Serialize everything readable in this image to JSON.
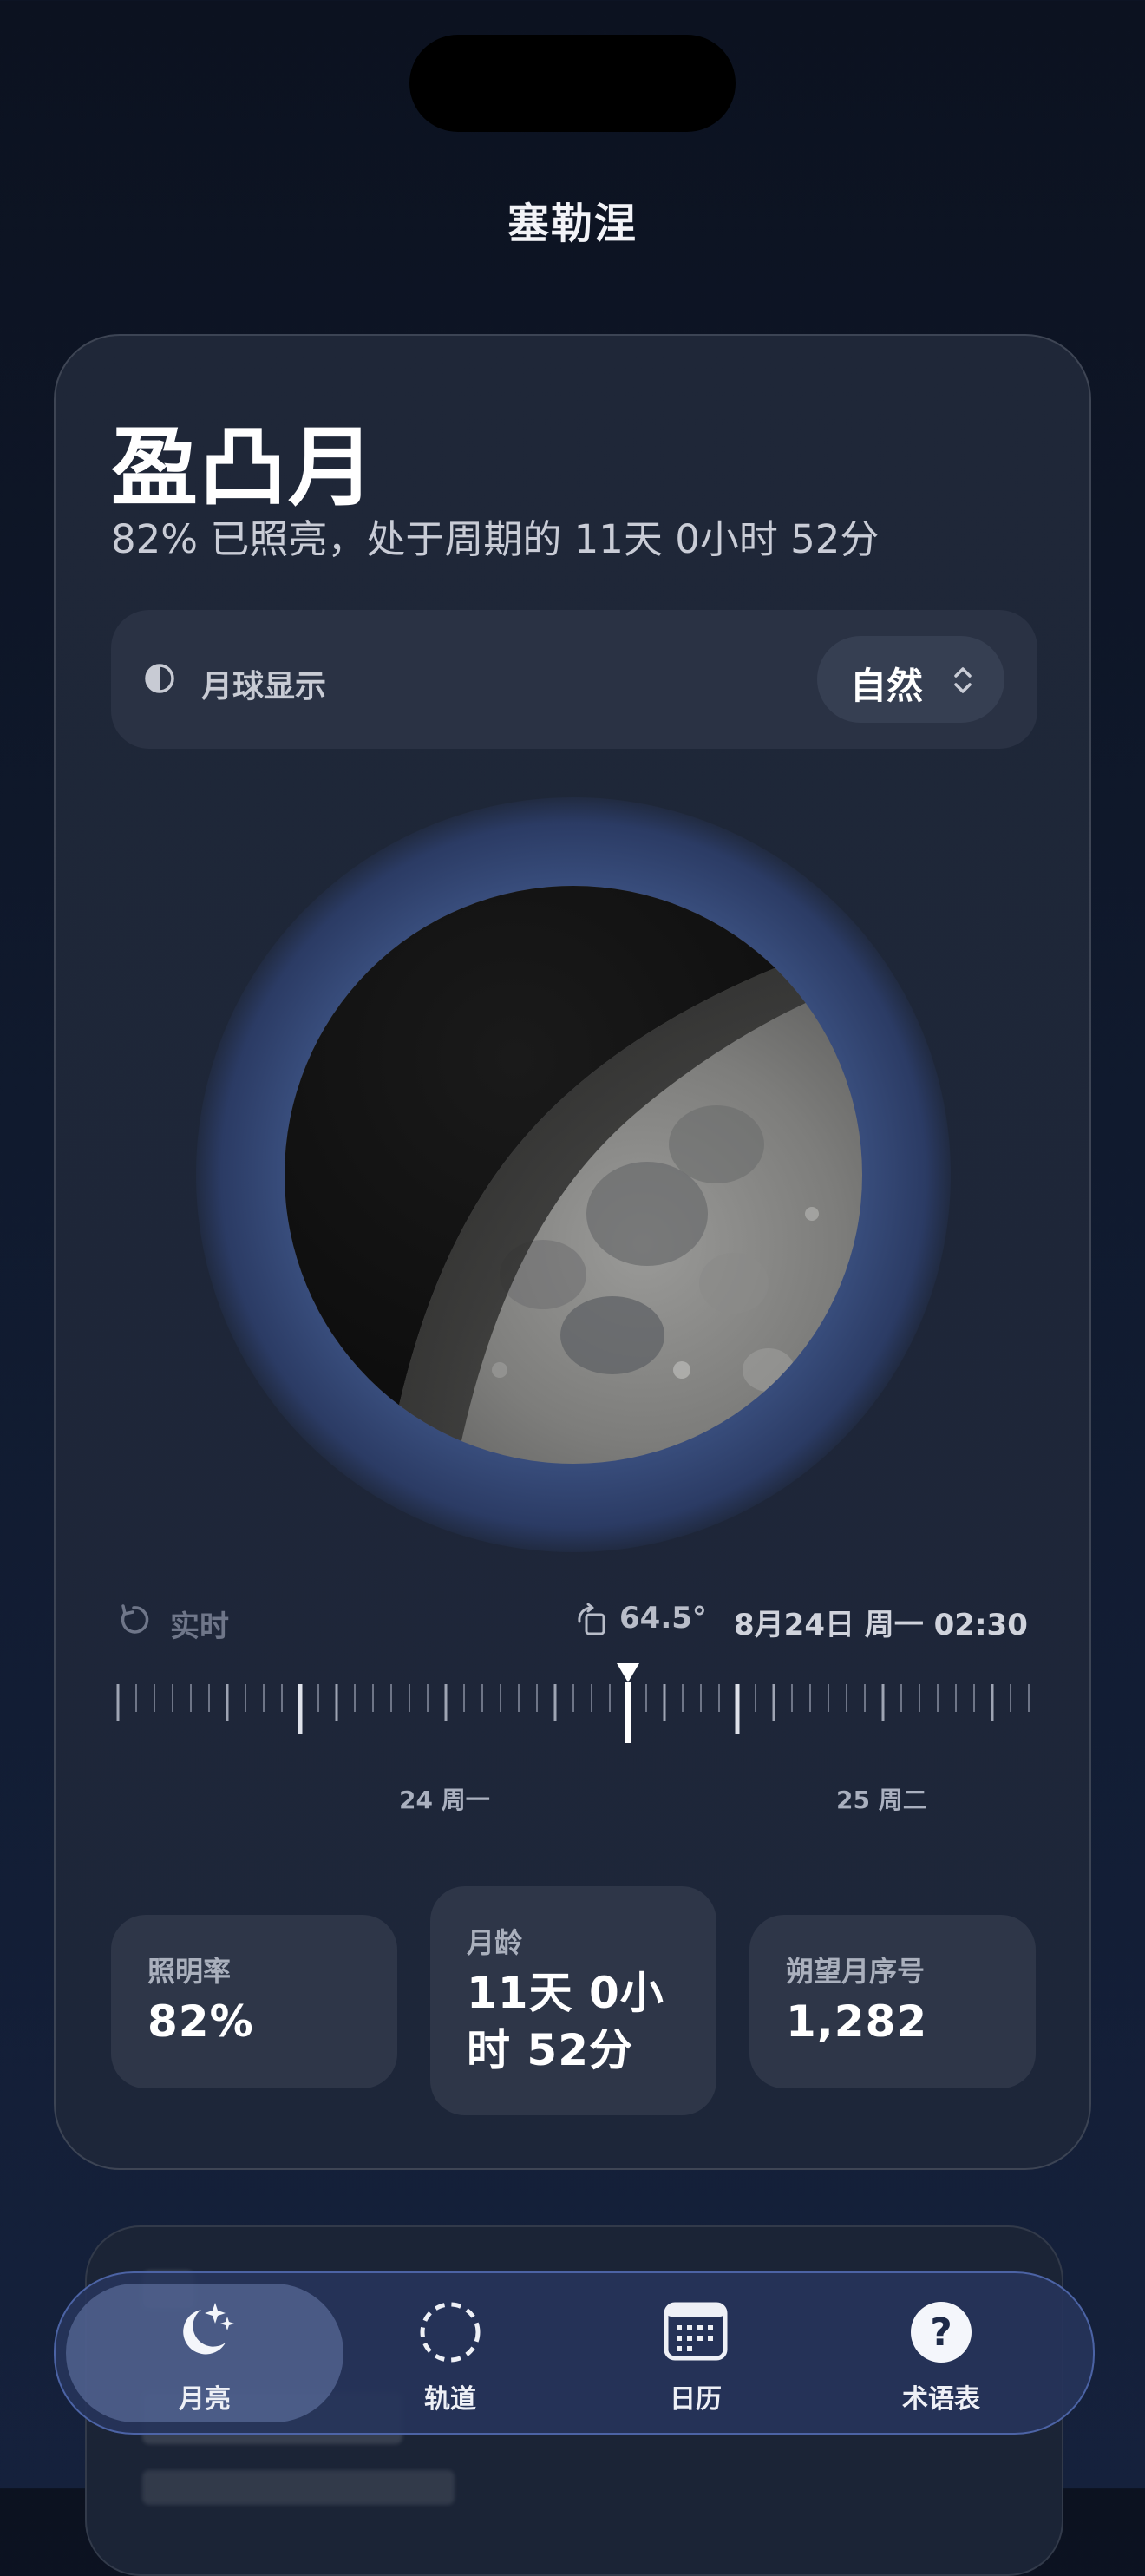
{
  "header": {
    "location": "塞勒涅"
  },
  "phase": {
    "name": "盈凸月",
    "subtitle": "82% 已照亮，处于周期的 11天 0小时 52分"
  },
  "display_mode": {
    "icon": "half-circle-icon",
    "label": "月球显示",
    "value": "自然"
  },
  "time_control": {
    "realtime_label": "实时",
    "tilt": "64.5°",
    "datetime": "8月24日 周一 02:30",
    "day_labels": [
      "24 周一",
      "25 周二"
    ]
  },
  "stats": [
    {
      "label": "照明率",
      "value": "82%"
    },
    {
      "label": "月龄",
      "value_line1": "11天 0小",
      "value_line2": "时 52分"
    },
    {
      "label": "朔望月序号",
      "value": "1,282"
    }
  ],
  "tabs": [
    {
      "label": "月亮",
      "icon": "moon-stars-icon",
      "active": true
    },
    {
      "label": "轨道",
      "icon": "orbit-icon",
      "active": false
    },
    {
      "label": "日历",
      "icon": "calendar-icon",
      "active": false
    },
    {
      "label": "术语表",
      "icon": "question-icon",
      "active": false
    }
  ],
  "colors": {
    "background": "#0c1220",
    "card": "#1f2738",
    "accent": "#4a6599"
  }
}
